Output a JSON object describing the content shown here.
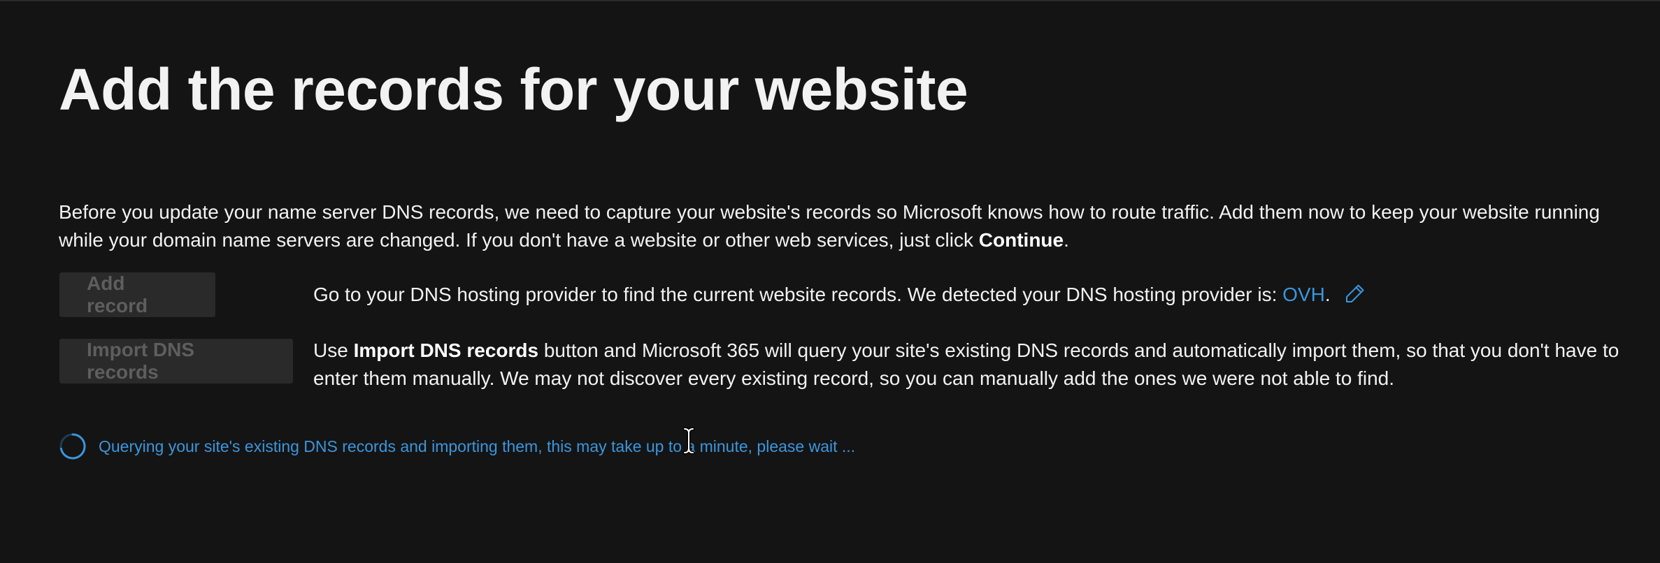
{
  "page": {
    "title": "Add the records for your website"
  },
  "intro": {
    "text": "Before you update your name server DNS records, we need to capture your website's records so Microsoft knows how to route traffic. Add them now to keep your website running while your domain name servers are changed. If you don't have a website or other web services, just click ",
    "bold": "Continue",
    "end": "."
  },
  "actions": {
    "add_record_label": "Add record",
    "import_dns_label": "Import DNS records"
  },
  "provider": {
    "text": "Go to your DNS hosting provider to find the current website records. We detected your DNS hosting provider is: ",
    "name": "OVH",
    "end": ".",
    "edit_icon": "pencil-icon"
  },
  "import_info": {
    "prefix": "Use ",
    "bold": "Import DNS records",
    "text": " button and Microsoft 365 will query your site's existing DNS records and automatically import them, so that you don't have to enter them manually. We may not discover every existing record, so you can manually add the ones we were not able to find."
  },
  "status": {
    "text": "Querying your site's existing DNS records and importing them, this may take up to a minute, please wait ...",
    "icon": "spinner-icon"
  },
  "colors": {
    "background": "#141414",
    "accent": "#3a96dd",
    "button_disabled_bg": "#2a2a2a",
    "button_disabled_text": "#5e5e5e"
  }
}
